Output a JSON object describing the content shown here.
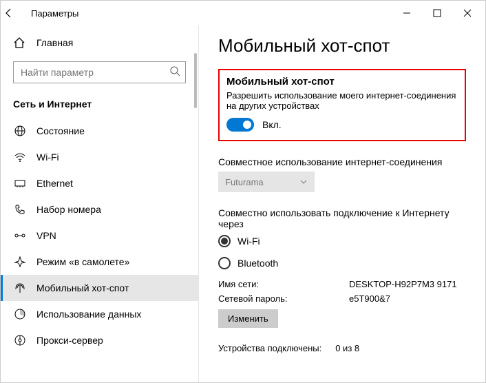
{
  "window": {
    "title": "Параметры"
  },
  "sidebar": {
    "home_label": "Главная",
    "search_placeholder": "Найти параметр",
    "section_title": "Сеть и Интернет",
    "items": [
      {
        "label": "Состояние"
      },
      {
        "label": "Wi-Fi"
      },
      {
        "label": "Ethernet"
      },
      {
        "label": "Набор номера"
      },
      {
        "label": "VPN"
      },
      {
        "label": "Режим «в самолете»"
      },
      {
        "label": "Мобильный хот-спот"
      },
      {
        "label": "Использование данных"
      },
      {
        "label": "Прокси-сервер"
      }
    ]
  },
  "main": {
    "page_title": "Мобильный хот-спот",
    "hotspot": {
      "title": "Мобильный хот-спот",
      "desc": "Разрешить использование моего интернет-соединения на других устройствах",
      "toggle_state": "Вкл."
    },
    "share_label": "Совместное использование интернет-соединения",
    "share_selected": "Futurama",
    "share_via_label": "Совместно использовать подключение к Интернету через",
    "radio_wifi": "Wi-Fi",
    "radio_bt": "Bluetooth",
    "net_name_label": "Имя сети:",
    "net_name_value": "DESKTOP-H92P7M3 9171",
    "net_pass_label": "Сетевой пароль:",
    "net_pass_value": "e5T900&7",
    "edit_button": "Изменить",
    "devices_label": "Устройства подключены:",
    "devices_value": "0 из 8"
  }
}
